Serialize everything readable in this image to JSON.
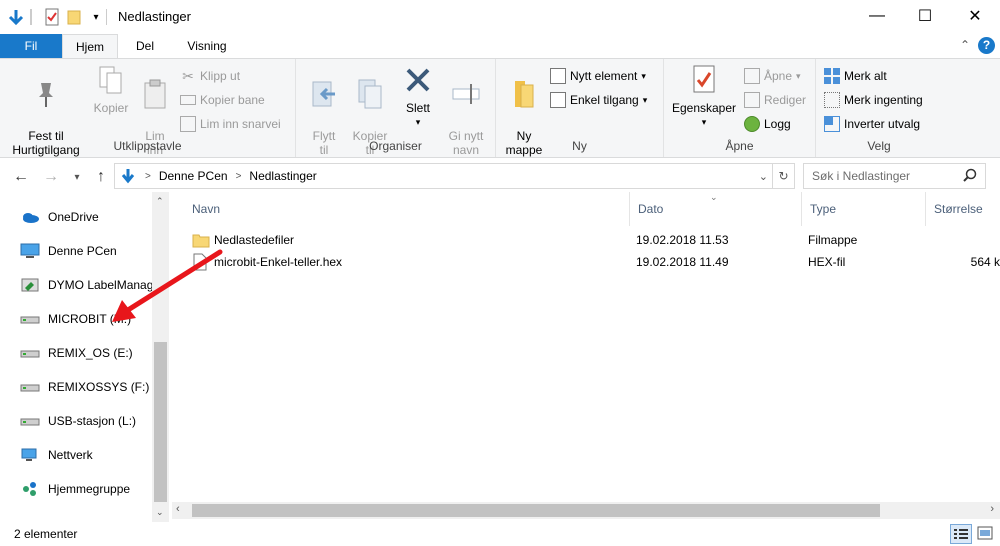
{
  "window": {
    "title": "Nedlastinger",
    "controls": {
      "minimize": "—",
      "maximize": "☐",
      "close": "✕"
    }
  },
  "ribbon_tabs": [
    "Fil",
    "Hjem",
    "Del",
    "Visning"
  ],
  "ribbon": {
    "clipboard": {
      "label": "Utklippstavle",
      "pin": "Fest til\nHurtigtilgang",
      "copy": "Kopier",
      "paste": "Lim\ninn",
      "cut": "Klipp ut",
      "copy_path": "Kopier bane",
      "paste_shortcut": "Lim inn snarvei"
    },
    "organize": {
      "label": "Organiser",
      "move_to": "Flytt\ntil",
      "copy_to": "Kopier\ntil",
      "delete": "Slett",
      "rename": "Gi nytt\nnavn"
    },
    "new": {
      "label": "Ny",
      "new_folder": "Ny\nmappe",
      "new_item": "Nytt element",
      "easy_access": "Enkel tilgang"
    },
    "open": {
      "label": "Åpne",
      "properties": "Egenskaper",
      "open": "Åpne",
      "edit": "Rediger",
      "history": "Logg"
    },
    "select": {
      "label": "Velg",
      "select_all": "Merk alt",
      "select_none": "Merk ingenting",
      "invert": "Inverter utvalg"
    }
  },
  "address": {
    "crumbs": [
      "Denne PCen",
      "Nedlastinger"
    ],
    "search_placeholder": "Søk i Nedlastinger"
  },
  "nav_items": [
    {
      "label": "OneDrive",
      "icon": "onedrive-icon"
    },
    {
      "label": "Denne PCen",
      "icon": "computer-icon"
    },
    {
      "label": "DYMO LabelManager",
      "icon": "dymo-drive-icon"
    },
    {
      "label": "MICROBIT (M:)",
      "icon": "drive-icon"
    },
    {
      "label": "REMIX_OS (E:)",
      "icon": "drive-icon"
    },
    {
      "label": "REMIXOSSYS (F:)",
      "icon": "drive-icon"
    },
    {
      "label": "USB-stasjon (L:)",
      "icon": "drive-icon"
    },
    {
      "label": "Nettverk",
      "icon": "network-icon"
    },
    {
      "label": "Hjemmegruppe",
      "icon": "homegroup-icon"
    }
  ],
  "columns": {
    "name": "Navn",
    "date": "Dato",
    "type": "Type",
    "size": "Størrelse"
  },
  "files": [
    {
      "name": "Nedlastedefiler",
      "date": "19.02.2018 11.53",
      "type": "Filmappe",
      "size": ""
    },
    {
      "name": "microbit-Enkel-teller.hex",
      "date": "19.02.2018 11.49",
      "type": "HEX-fil",
      "size": "564 k"
    }
  ],
  "status": {
    "count": "2 elementer"
  },
  "colors": {
    "accent": "#1979ca",
    "arrow": "#e8161b"
  }
}
